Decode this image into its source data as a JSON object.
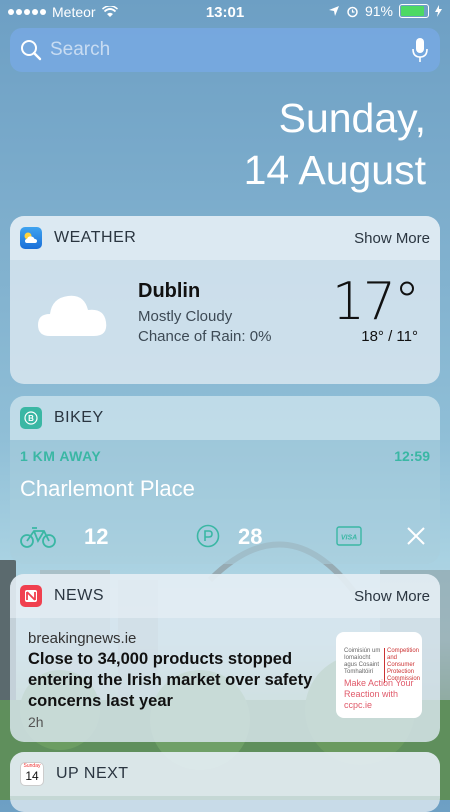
{
  "status_bar": {
    "carrier": "Meteor",
    "time": "13:01",
    "battery": "91%",
    "battery_level": 0.91
  },
  "search": {
    "placeholder": "Search"
  },
  "date": {
    "day": "Sunday,",
    "date": "14 August"
  },
  "weather": {
    "title": "WEATHER",
    "show_more": "Show More",
    "city": "Dublin",
    "condition": "Mostly Cloudy",
    "rain": "Chance of Rain: 0%",
    "temperature": "17°",
    "hilo": "18° / 11°"
  },
  "bikey": {
    "title": "BIKEY",
    "distance": "1 KM AWAY",
    "time": "12:59",
    "place": "Charlemont Place",
    "bikes": "12",
    "parking": "28"
  },
  "news": {
    "title": "NEWS",
    "show_more": "Show More",
    "source": "breakingnews.ie",
    "headline": "Close to 34,000 products stopped entering the Irish market over safety concerns last year",
    "age": "2h",
    "thumb_left": "Coimisiún um Iomaíocht agus Cosaint Tomhaltóirí",
    "thumb_right": "Competition and Consumer Protection Commission",
    "thumb_promo": "Make Action Your Reaction with ccpc.ie"
  },
  "upnext": {
    "title": "UP NEXT",
    "cal_day": "Sunday",
    "cal_date": "14"
  },
  "colors": {
    "accent_teal": "#3ab7a4",
    "battery_green": "#4cd964"
  }
}
